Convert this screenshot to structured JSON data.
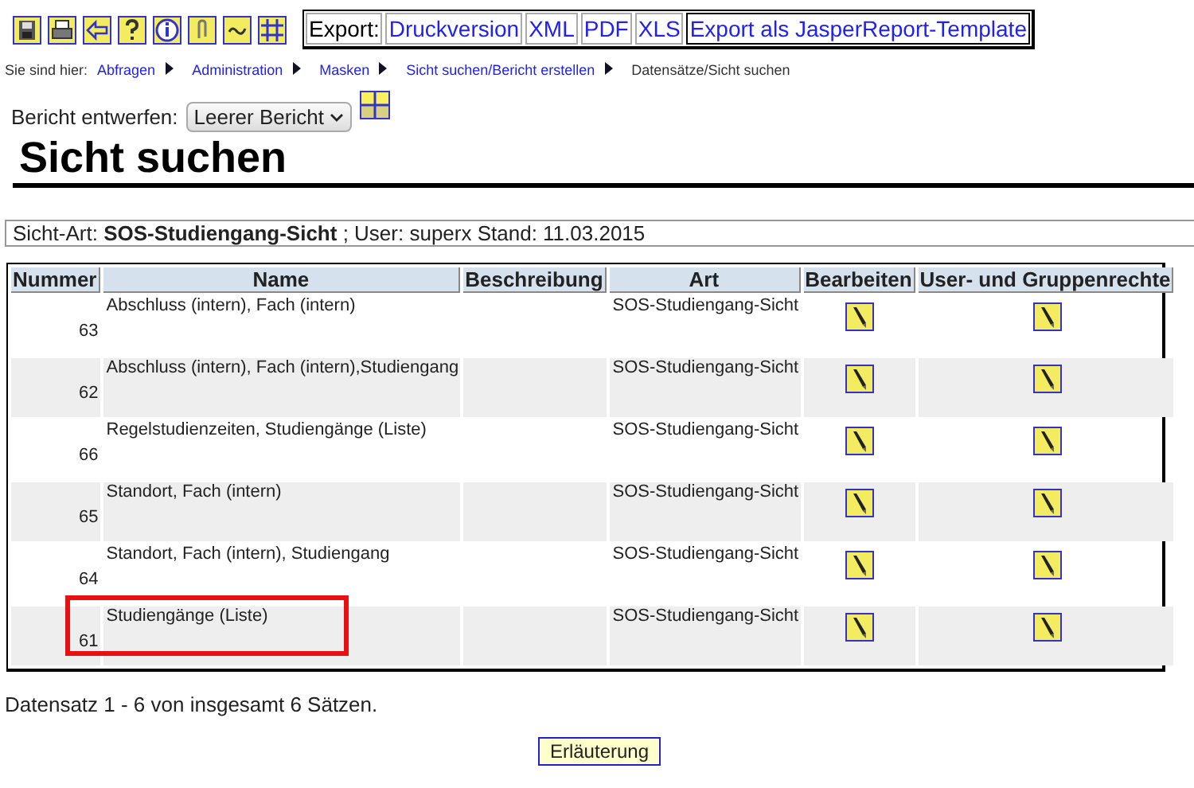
{
  "export": {
    "label": "Export:",
    "links": [
      "Druckversion",
      "XML",
      "PDF",
      "XLS",
      "Export als JasperReport-Template"
    ]
  },
  "breadcrumb": {
    "label": "Sie sind hier:",
    "links": [
      "Abfragen",
      "Administration",
      "Masken",
      "Sicht suchen/Bericht erstellen"
    ],
    "current": "Datensätze/Sicht suchen"
  },
  "report": {
    "label": "Bericht entwerfen:",
    "value": "Leerer Bericht"
  },
  "title": "Sicht suchen",
  "info": "Sicht-Art:  **SOS-Studiengang-Sicht** ; User: superx  Stand: 11.03.2015",
  "table": {
    "columns": [
      "Nummer",
      "Name",
      "Beschreibung",
      "Art",
      "Bearbeiten",
      "User- und Gruppenrechte"
    ],
    "rows": [
      {
        "nummer": "63",
        "name": "Abschluss (intern), Fach (intern)",
        "art": "SOS-Studiengang-Sicht",
        "highlighted": false
      },
      {
        "nummer": "62",
        "name": "Abschluss (intern), Fach (intern),Studiengang",
        "art": "SOS-Studiengang-Sicht",
        "highlighted": false
      },
      {
        "nummer": "66",
        "name": "Regelstudienzeiten, Studiengänge (Liste)",
        "art": "SOS-Studiengang-Sicht",
        "highlighted": false
      },
      {
        "nummer": "65",
        "name": "Standort, Fach (intern)",
        "art": "SOS-Studiengang-Sicht",
        "highlighted": false
      },
      {
        "nummer": "64",
        "name": "Standort, Fach (intern), Studiengang",
        "art": "SOS-Studiengang-Sicht",
        "highlighted": false
      },
      {
        "nummer": "61",
        "name": "Studiengänge (Liste)",
        "art": "SOS-Studiengang-Sicht",
        "highlighted": true
      }
    ]
  },
  "summary": "Datensatz 1 - 6 von insgesamt 6 Sätzen.",
  "button": "Erläuterung"
}
